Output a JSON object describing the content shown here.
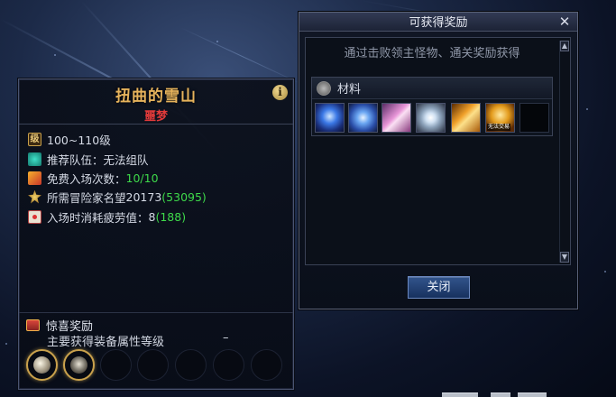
{
  "dungeon": {
    "title": "扭曲的雪山",
    "difficulty": "噩梦",
    "info_icon": "info-icon",
    "rows": [
      {
        "icon": "level-icon",
        "icon_text": "级",
        "label": "100~110级"
      },
      {
        "icon": "party-icon",
        "label": "推荐队伍：无法组队"
      },
      {
        "icon": "entry-ticket-icon",
        "label": "免费入场次数：",
        "value": "10/10"
      },
      {
        "icon": "fame-icon",
        "label": "所需冒险家名望 ",
        "value": "20173",
        "value_green": "(53095)"
      },
      {
        "icon": "fatigue-icon",
        "label": "入场时消耗疲劳值：",
        "value": "8",
        "value_green": "(188)"
      }
    ],
    "bonus": {
      "icon": "chest-icon",
      "heading": "惊喜奖励",
      "subtitle": "主要获得装备属性等级",
      "dash": "–",
      "slots": [
        "filled",
        "filled",
        "empty",
        "empty",
        "empty",
        "empty",
        "empty"
      ]
    }
  },
  "reward_window": {
    "title": "可获得奖励",
    "close_glyph": "✕",
    "description": "通过击败领主怪物、通关奖励获得",
    "material_group": {
      "icon": "material-icon",
      "label": "材料",
      "items": [
        {
          "name": "blue-orb-item"
        },
        {
          "name": "blue-crystal-item"
        },
        {
          "name": "pink-gem-item"
        },
        {
          "name": "white-star-item"
        },
        {
          "name": "gold-gem-item"
        },
        {
          "name": "gold-token-item",
          "badge": "无法交易"
        },
        {
          "name": "empty-item-slot",
          "empty": true
        }
      ]
    },
    "close_button": "关闭"
  },
  "colors": {
    "title_gold": "#e6b35c",
    "difficulty_red": "#e23a3a",
    "value_green": "#3ed94a"
  }
}
